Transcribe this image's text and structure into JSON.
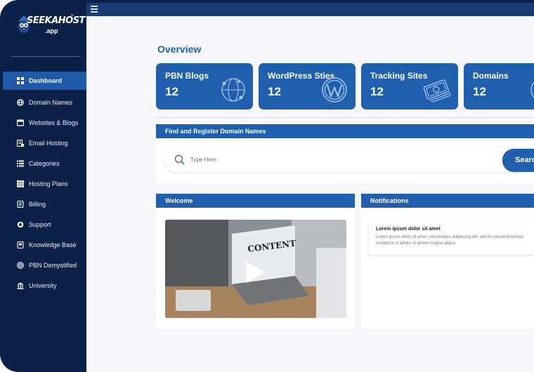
{
  "logo": {
    "text": "SEEKAHOST",
    "sub": ".app",
    "tm": "™"
  },
  "sidebar": {
    "items": [
      {
        "label": "Dashboard",
        "icon": "dashboard-grid-icon",
        "active": true
      },
      {
        "label": "Domain Names",
        "icon": "globe-icon"
      },
      {
        "label": "Websites & Blogs",
        "icon": "browser-icon"
      },
      {
        "label": "Email Hosting",
        "icon": "email-server-icon"
      },
      {
        "label": "Categories",
        "icon": "list-icon"
      },
      {
        "label": "Hosting Plans",
        "icon": "grid-icon"
      },
      {
        "label": "Billing",
        "icon": "invoice-icon"
      },
      {
        "label": "Support",
        "icon": "support-icon"
      },
      {
        "label": "Knowledge Base",
        "icon": "book-icon"
      },
      {
        "label": "PBN Demystified",
        "icon": "target-icon"
      },
      {
        "label": "University",
        "icon": "university-icon"
      }
    ]
  },
  "topbar": {
    "menu_icon": "hamburger-menu-icon"
  },
  "main": {
    "title": "Overview",
    "cards": [
      {
        "title": "PBN Blogs",
        "value": "12",
        "icon": "network-globe-icon"
      },
      {
        "title": "WordPress Sties",
        "value": "12",
        "icon": "wordpress-icon"
      },
      {
        "title": "Tracking Sites",
        "value": "12",
        "icon": "money-icon"
      },
      {
        "title": "Domains",
        "value": "12",
        "icon": "globe-icon"
      }
    ],
    "domain_search": {
      "heading": "Find and Register Domain Names",
      "placeholder": "Type Here",
      "button": "Search"
    },
    "welcome": {
      "heading": "Welcome",
      "video_text": "CONTENT"
    },
    "notifications": {
      "heading": "Notifications",
      "items": [
        {
          "title": "Lorem ipsum dolor sit amet",
          "text": "Lorem ipsum dolor sit amet, consectetur adipiscing elit, sed do eiusmod tempor incididunt ut labore et dolore magna aliqua"
        }
      ]
    }
  },
  "colors": {
    "sidebar": "#0b2148",
    "accent": "#1f5fae",
    "active": "#1f59a8"
  }
}
